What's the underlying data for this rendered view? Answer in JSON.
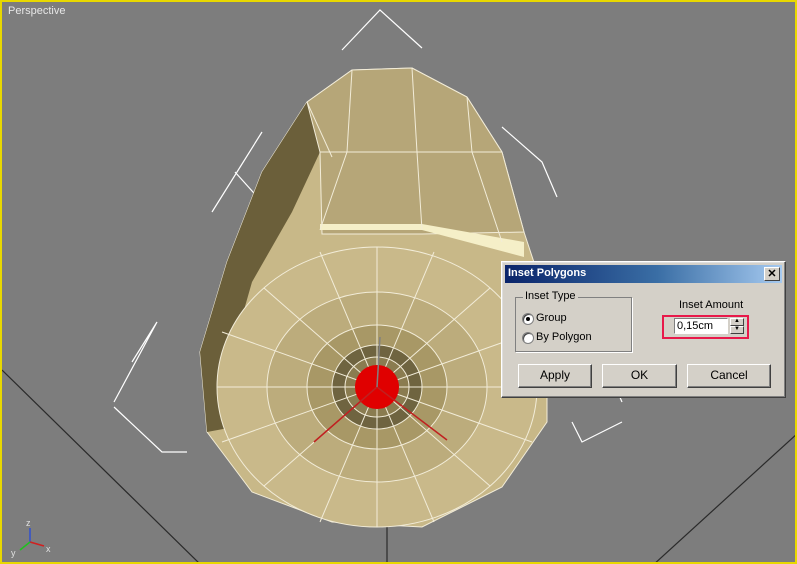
{
  "viewport": {
    "label": "Perspective",
    "axis": {
      "x": "x",
      "y": "y",
      "z": "z"
    }
  },
  "dialog": {
    "title": "Inset Polygons",
    "close_glyph": "✕",
    "inset_type": {
      "legend": "Inset Type",
      "options": [
        "Group",
        "By Polygon"
      ],
      "selected": "Group"
    },
    "inset_amount": {
      "label": "Inset Amount",
      "value": "0,15cm"
    },
    "buttons": {
      "apply": "Apply",
      "ok": "OK",
      "cancel": "Cancel"
    }
  },
  "colors": {
    "viewport_bg": "#7d7d7d",
    "active_border": "#e8d800",
    "mesh": "#c8b888",
    "selection": "#e00000",
    "highlight_box": "#e8194a",
    "title_bar": "#0a246a"
  }
}
